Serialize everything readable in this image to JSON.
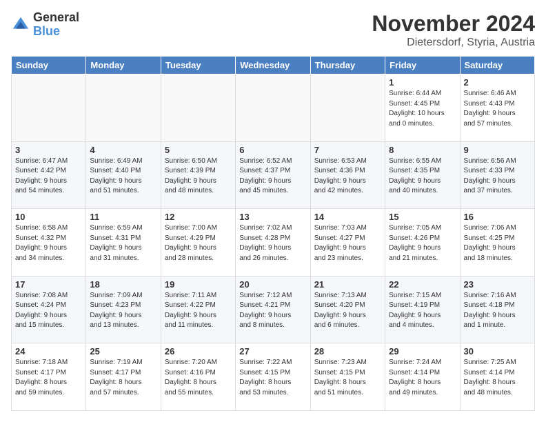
{
  "logo": {
    "general": "General",
    "blue": "Blue"
  },
  "header": {
    "title": "November 2024",
    "location": "Dietersdorf, Styria, Austria"
  },
  "weekdays": [
    "Sunday",
    "Monday",
    "Tuesday",
    "Wednesday",
    "Thursday",
    "Friday",
    "Saturday"
  ],
  "weeks": [
    [
      {
        "day": "",
        "info": ""
      },
      {
        "day": "",
        "info": ""
      },
      {
        "day": "",
        "info": ""
      },
      {
        "day": "",
        "info": ""
      },
      {
        "day": "",
        "info": ""
      },
      {
        "day": "1",
        "info": "Sunrise: 6:44 AM\nSunset: 4:45 PM\nDaylight: 10 hours\nand 0 minutes."
      },
      {
        "day": "2",
        "info": "Sunrise: 6:46 AM\nSunset: 4:43 PM\nDaylight: 9 hours\nand 57 minutes."
      }
    ],
    [
      {
        "day": "3",
        "info": "Sunrise: 6:47 AM\nSunset: 4:42 PM\nDaylight: 9 hours\nand 54 minutes."
      },
      {
        "day": "4",
        "info": "Sunrise: 6:49 AM\nSunset: 4:40 PM\nDaylight: 9 hours\nand 51 minutes."
      },
      {
        "day": "5",
        "info": "Sunrise: 6:50 AM\nSunset: 4:39 PM\nDaylight: 9 hours\nand 48 minutes."
      },
      {
        "day": "6",
        "info": "Sunrise: 6:52 AM\nSunset: 4:37 PM\nDaylight: 9 hours\nand 45 minutes."
      },
      {
        "day": "7",
        "info": "Sunrise: 6:53 AM\nSunset: 4:36 PM\nDaylight: 9 hours\nand 42 minutes."
      },
      {
        "day": "8",
        "info": "Sunrise: 6:55 AM\nSunset: 4:35 PM\nDaylight: 9 hours\nand 40 minutes."
      },
      {
        "day": "9",
        "info": "Sunrise: 6:56 AM\nSunset: 4:33 PM\nDaylight: 9 hours\nand 37 minutes."
      }
    ],
    [
      {
        "day": "10",
        "info": "Sunrise: 6:58 AM\nSunset: 4:32 PM\nDaylight: 9 hours\nand 34 minutes."
      },
      {
        "day": "11",
        "info": "Sunrise: 6:59 AM\nSunset: 4:31 PM\nDaylight: 9 hours\nand 31 minutes."
      },
      {
        "day": "12",
        "info": "Sunrise: 7:00 AM\nSunset: 4:29 PM\nDaylight: 9 hours\nand 28 minutes."
      },
      {
        "day": "13",
        "info": "Sunrise: 7:02 AM\nSunset: 4:28 PM\nDaylight: 9 hours\nand 26 minutes."
      },
      {
        "day": "14",
        "info": "Sunrise: 7:03 AM\nSunset: 4:27 PM\nDaylight: 9 hours\nand 23 minutes."
      },
      {
        "day": "15",
        "info": "Sunrise: 7:05 AM\nSunset: 4:26 PM\nDaylight: 9 hours\nand 21 minutes."
      },
      {
        "day": "16",
        "info": "Sunrise: 7:06 AM\nSunset: 4:25 PM\nDaylight: 9 hours\nand 18 minutes."
      }
    ],
    [
      {
        "day": "17",
        "info": "Sunrise: 7:08 AM\nSunset: 4:24 PM\nDaylight: 9 hours\nand 15 minutes."
      },
      {
        "day": "18",
        "info": "Sunrise: 7:09 AM\nSunset: 4:23 PM\nDaylight: 9 hours\nand 13 minutes."
      },
      {
        "day": "19",
        "info": "Sunrise: 7:11 AM\nSunset: 4:22 PM\nDaylight: 9 hours\nand 11 minutes."
      },
      {
        "day": "20",
        "info": "Sunrise: 7:12 AM\nSunset: 4:21 PM\nDaylight: 9 hours\nand 8 minutes."
      },
      {
        "day": "21",
        "info": "Sunrise: 7:13 AM\nSunset: 4:20 PM\nDaylight: 9 hours\nand 6 minutes."
      },
      {
        "day": "22",
        "info": "Sunrise: 7:15 AM\nSunset: 4:19 PM\nDaylight: 9 hours\nand 4 minutes."
      },
      {
        "day": "23",
        "info": "Sunrise: 7:16 AM\nSunset: 4:18 PM\nDaylight: 9 hours\nand 1 minute."
      }
    ],
    [
      {
        "day": "24",
        "info": "Sunrise: 7:18 AM\nSunset: 4:17 PM\nDaylight: 8 hours\nand 59 minutes."
      },
      {
        "day": "25",
        "info": "Sunrise: 7:19 AM\nSunset: 4:17 PM\nDaylight: 8 hours\nand 57 minutes."
      },
      {
        "day": "26",
        "info": "Sunrise: 7:20 AM\nSunset: 4:16 PM\nDaylight: 8 hours\nand 55 minutes."
      },
      {
        "day": "27",
        "info": "Sunrise: 7:22 AM\nSunset: 4:15 PM\nDaylight: 8 hours\nand 53 minutes."
      },
      {
        "day": "28",
        "info": "Sunrise: 7:23 AM\nSunset: 4:15 PM\nDaylight: 8 hours\nand 51 minutes."
      },
      {
        "day": "29",
        "info": "Sunrise: 7:24 AM\nSunset: 4:14 PM\nDaylight: 8 hours\nand 49 minutes."
      },
      {
        "day": "30",
        "info": "Sunrise: 7:25 AM\nSunset: 4:14 PM\nDaylight: 8 hours\nand 48 minutes."
      }
    ]
  ]
}
